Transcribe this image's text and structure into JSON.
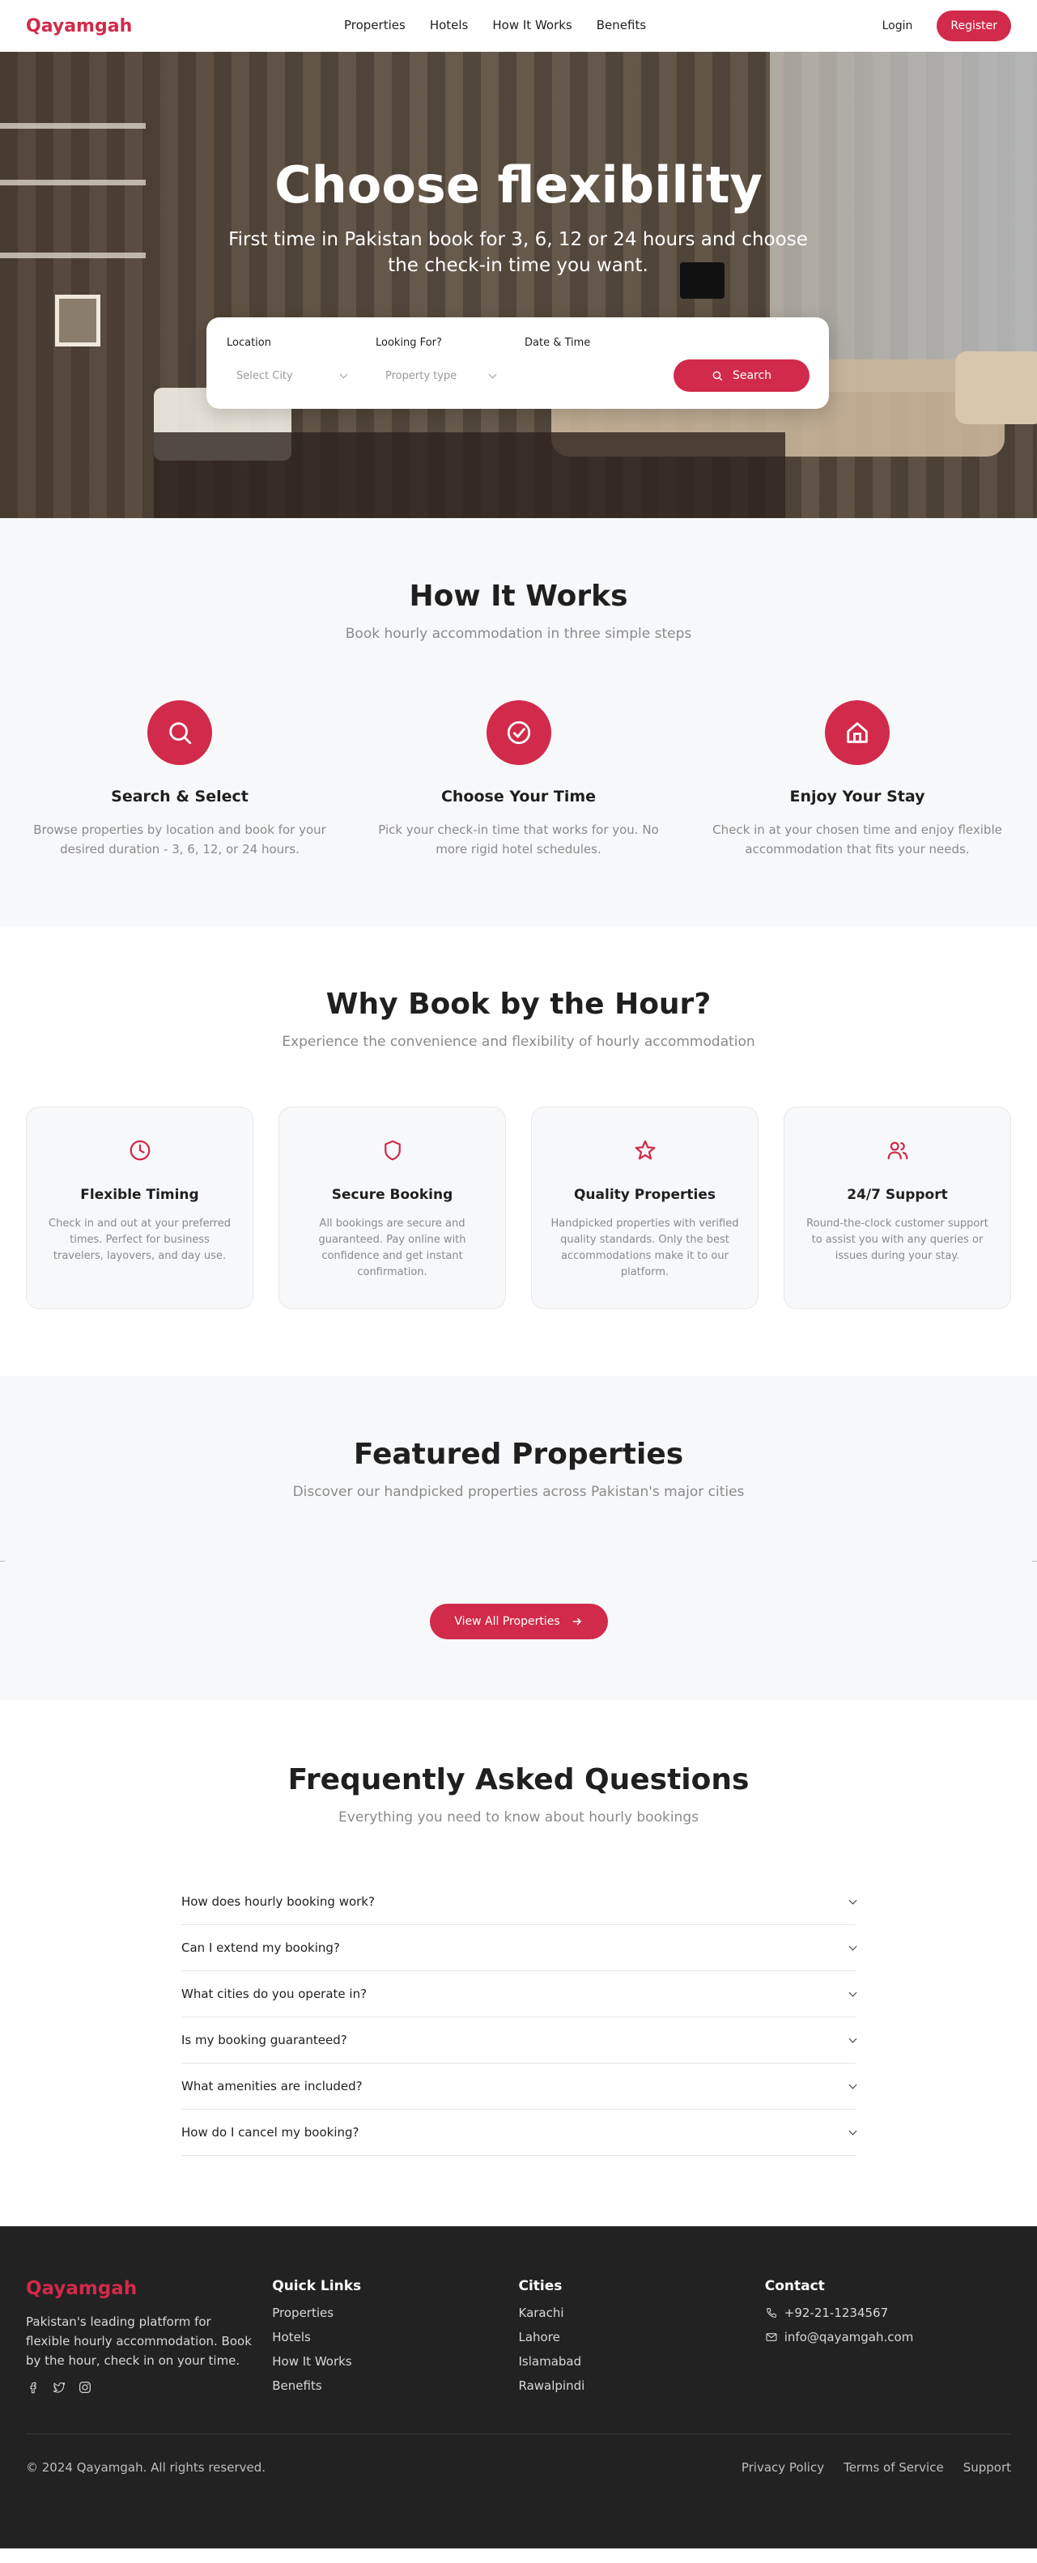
{
  "nav": {
    "brand": "Qayamgah",
    "links": [
      "Properties",
      "Hotels",
      "How It Works",
      "Benefits"
    ],
    "login": "Login",
    "register": "Register"
  },
  "hero": {
    "title": "Choose flexibility",
    "subtitle": "First time in Pakistan book for 3, 6, 12 or 24 hours and choose the check-in time you want.",
    "search": {
      "location_label": "Location",
      "location_placeholder": "Select City",
      "looking_label": "Looking For?",
      "looking_placeholder": "Property type",
      "date_label": "Date & Time",
      "button": "Search"
    }
  },
  "how": {
    "title": "How It Works",
    "subtitle": "Book hourly accommodation in three simple steps",
    "steps": [
      {
        "icon": "search-icon",
        "title": "Search & Select",
        "text": "Browse properties by location and book for your desired duration - 3, 6, 12, or 24 hours."
      },
      {
        "icon": "check-circle-icon",
        "title": "Choose Your Time",
        "text": "Pick your check-in time that works for you. No more rigid hotel schedules."
      },
      {
        "icon": "home-icon",
        "title": "Enjoy Your Stay",
        "text": "Check in at your chosen time and enjoy flexible accommodation that fits your needs."
      }
    ]
  },
  "why": {
    "title": "Why Book by the Hour?",
    "subtitle": "Experience the convenience and flexibility of hourly accommodation",
    "cards": [
      {
        "icon": "clock-icon",
        "title": "Flexible Timing",
        "text": "Check in and out at your preferred times. Perfect for business travelers, layovers, and day use."
      },
      {
        "icon": "shield-icon",
        "title": "Secure Booking",
        "text": "All bookings are secure and guaranteed. Pay online with confidence and get instant confirmation."
      },
      {
        "icon": "star-icon",
        "title": "Quality Properties",
        "text": "Handpicked properties with verified quality standards. Only the best accommodations make it to our platform."
      },
      {
        "icon": "users-icon",
        "title": "24/7 Support",
        "text": "Round-the-clock customer support to assist you with any queries or issues during your stay."
      }
    ]
  },
  "featured": {
    "title": "Featured Properties",
    "subtitle": "Discover our handpicked properties across Pakistan's major cities",
    "button": "View All Properties"
  },
  "faq": {
    "title": "Frequently Asked Questions",
    "subtitle": "Everything you need to know about hourly bookings",
    "items": [
      "How does hourly booking work?",
      "Can I extend my booking?",
      "What cities do you operate in?",
      "Is my booking guaranteed?",
      "What amenities are included?",
      "How do I cancel my booking?"
    ]
  },
  "footer": {
    "brand": "Qayamgah",
    "description": "Pakistan's leading platform for flexible hourly accommodation. Book by the hour, check in on your time.",
    "quick_links_title": "Quick Links",
    "quick_links": [
      "Properties",
      "Hotels",
      "How It Works",
      "Benefits"
    ],
    "cities_title": "Cities",
    "cities": [
      "Karachi",
      "Lahore",
      "Islamabad",
      "Rawalpindi"
    ],
    "contact_title": "Contact",
    "phone": "+92-21-1234567",
    "email": "info@qayamgah.com",
    "copyright": "© 2024 Qayamgah. All rights reserved.",
    "bottom_links": [
      "Privacy Policy",
      "Terms of Service",
      "Support"
    ]
  },
  "colors": {
    "accent": "#d12a4a",
    "footer_bg": "#222222",
    "section_gray": "#f7f8fa"
  }
}
